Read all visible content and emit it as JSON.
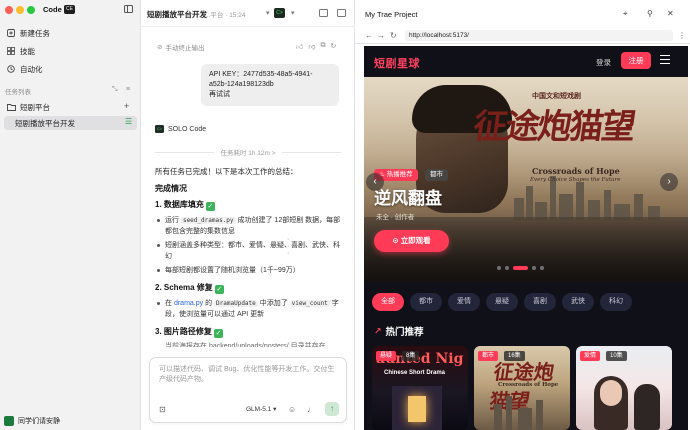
{
  "app": {
    "brand": "Code",
    "badge": "CE"
  },
  "sidebar": {
    "nav": [
      {
        "label": "新建任务"
      },
      {
        "label": "技能"
      },
      {
        "label": "自动化"
      }
    ],
    "section_label": "任务列表",
    "project": {
      "name": "短剧平台"
    },
    "task": {
      "name": "短剧播放平台开发"
    },
    "user": {
      "name": "同学们请安静"
    }
  },
  "chat": {
    "title": "短剧播放平台开发",
    "meta": "...平台 · 15:24",
    "terminal_badge": "C>",
    "stopped_note": "手动终止输出",
    "user_message": {
      "line1": "API KEY：2477d535-48a5-4941-",
      "line2": "a52b-124a198123db",
      "line3": "再试试"
    },
    "agent_name": "SOLO Code",
    "agent_badge": "C>",
    "elapsed": "任务耗时 1h 12m >",
    "summary": "所有任务已完成！以下是本次工作的总结：",
    "section_title": "完成情况",
    "blocks": [
      {
        "heading": "1. 数据库填充",
        "bullets": [
          {
            "pre": "运行 ",
            "code": "seed_dramas.py",
            "post": " 成功创建了 12部短剧 数据，每部都包含完整的集数信息"
          },
          {
            "text": "短剧涵盖多种类型：都市、爱情、悬疑、喜剧、武侠、科幻"
          },
          {
            "text": "每部短剧都设置了随机浏览量（1千~99万）"
          }
        ]
      },
      {
        "heading": "2. Schema 修复",
        "bullets": [
          {
            "pre": "在 ",
            "link": "drama.py",
            "mid": " 的 ",
            "code": "DramaUpdate",
            "mid2": " 中添加了 ",
            "code2": "view_count",
            "post": " 字段，使浏览量可以通过 API 更新"
          }
        ]
      },
      {
        "heading": "3. 图片路径修复",
        "bullets": []
      }
    ],
    "partial_line": "当前海报存在 backend/uploads/posters/ 目录并存在",
    "composer": {
      "placeholder": "可以描述代码、调试 Bug、优化性能等开发工作。交付生产级代码产物。",
      "model": "GLM-5.1"
    }
  },
  "preview": {
    "title": "My Trae Project",
    "url": "http://localhost:5173/"
  },
  "site": {
    "logo": "短剧星球",
    "login": "登录",
    "register": "注册",
    "hero": {
      "poster_small": "中国文和短戏剧",
      "poster_title": "征途炮猫望",
      "poster_en1": "Crossroads of Hope",
      "poster_en2": "Every Choice Shapes the Future",
      "tag_hot": "热播推荐",
      "tag_genre": "都市",
      "title": "逆风翻盘",
      "sub": "未全 · 创作者",
      "watch": "立即观看"
    },
    "slides": {
      "count": 5,
      "active_index": 2
    },
    "categories": [
      "全部",
      "都市",
      "爱情",
      "悬疑",
      "喜剧",
      "武侠",
      "科幻"
    ],
    "active_category": "全部",
    "section_title": "热门推荐",
    "cards": [
      {
        "badge": "悬疑",
        "badge_color": "#ff3b57",
        "episodes": "8集",
        "poster_text": "aunted Nig",
        "poster_sub": "Chinese Short Drama"
      },
      {
        "badge": "都市",
        "badge_color": "#ff3b57",
        "episodes": "16集",
        "poster_text": "征途炮猫望",
        "poster_sub": "Crossroads of Hope"
      },
      {
        "badge": "爱情",
        "badge_color": "#ff3b57",
        "episodes": "10集",
        "poster_text": "",
        "poster_sub": ""
      }
    ]
  },
  "colors": {
    "accent": "#ff3b57",
    "site_bg": "#0f1018",
    "check": "#3cb45a"
  }
}
